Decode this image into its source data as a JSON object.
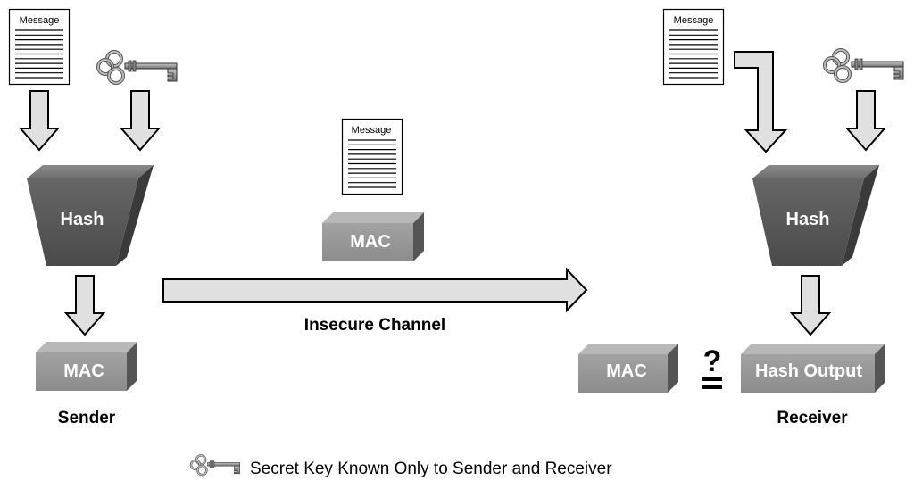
{
  "sender": {
    "message_label": "Message",
    "hash_label": "Hash",
    "mac_label": "MAC",
    "caption": "Sender"
  },
  "channel": {
    "message_label": "Message",
    "mac_label": "MAC",
    "caption": "Insecure Channel"
  },
  "receiver": {
    "message_label": "Message",
    "hash_label": "Hash",
    "mac_label": "MAC",
    "compare_symbol": "?",
    "hash_output_label": "Hash Output",
    "caption": "Receiver"
  },
  "legend": {
    "icon": "key-icon",
    "text": "Secret Key Known Only to Sender and Receiver"
  },
  "colors": {
    "hash_front": "#5a5a5a",
    "box_front": "#9a9a9a",
    "arrow_fill": "#e0e0e0"
  }
}
